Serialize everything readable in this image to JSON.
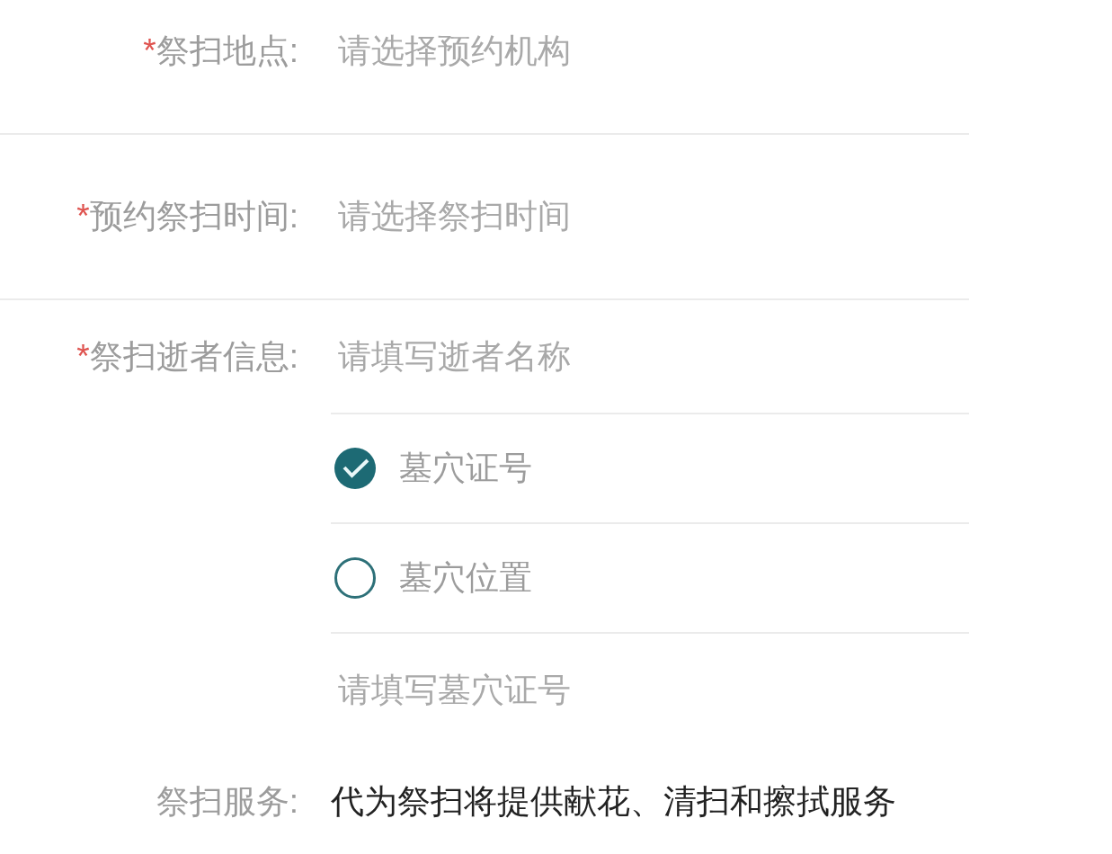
{
  "form": {
    "fields": [
      {
        "kind": "select",
        "required_mark": "*",
        "label": "祭扫地点:",
        "placeholder": "请选择预约机构"
      },
      {
        "kind": "select",
        "required_mark": "*",
        "label": "预约祭扫时间:",
        "placeholder": "请选择祭扫时间"
      },
      {
        "kind": "deceased",
        "required_mark": "*",
        "label": "祭扫逝者信息:",
        "name_input": {
          "placeholder": "请填写逝者名称"
        },
        "id_type_options": [
          {
            "label": "墓穴证号",
            "selected": true
          },
          {
            "label": "墓穴位置",
            "selected": false
          }
        ],
        "id_input": {
          "placeholder": "请填写墓穴证号"
        }
      },
      {
        "kind": "info",
        "label": "祭扫服务:",
        "value": "代为祭扫将提供献花、清扫和擦拭服务"
      }
    ]
  }
}
